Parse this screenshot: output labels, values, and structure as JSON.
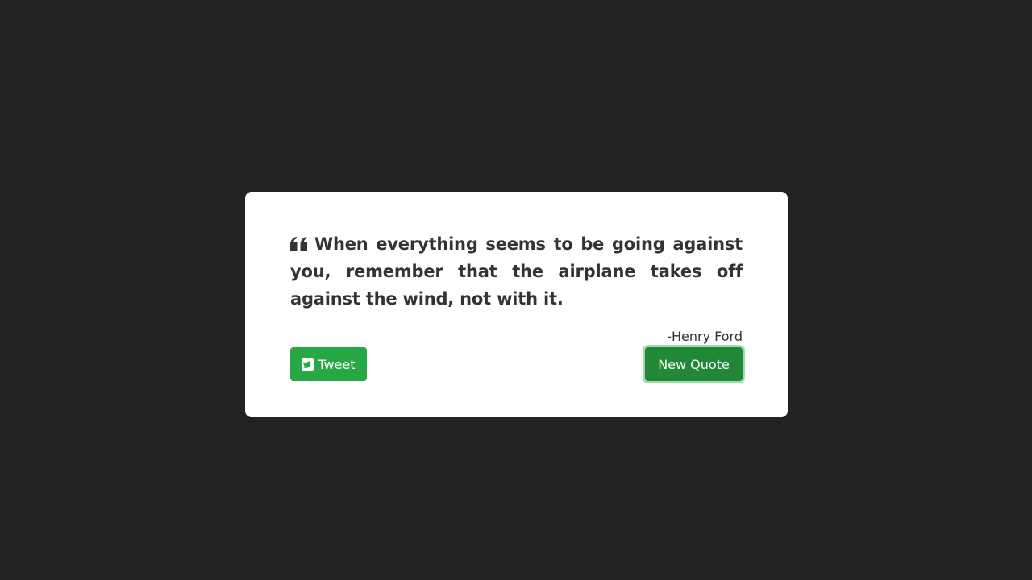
{
  "quote": {
    "text": "When everything seems to be going against you, remember that the airplane takes off against the wind, not with it.",
    "author": "-Henry Ford",
    "icon": "quote-left-icon"
  },
  "buttons": {
    "tweet_label": "Tweet",
    "tweet_icon": "twitter-square-icon",
    "new_quote_label": "New Quote"
  },
  "colors": {
    "background": "#222222",
    "card": "#ffffff",
    "text": "#333333",
    "button_green": "#28a745",
    "button_green_active": "#218838"
  }
}
